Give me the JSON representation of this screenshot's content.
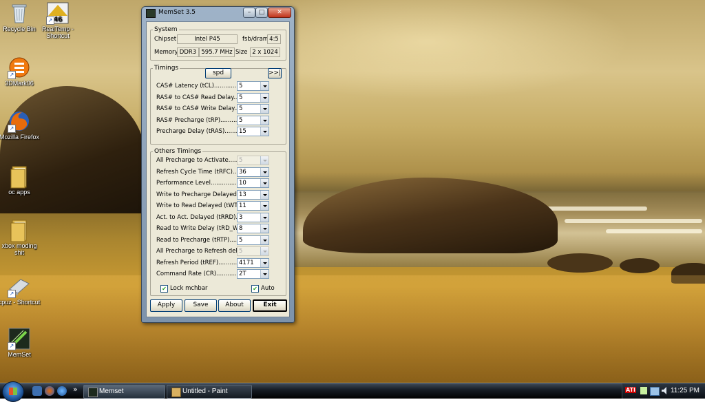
{
  "desktop": {
    "icons": [
      {
        "label": "Recycle Bin"
      },
      {
        "label": "RealTemp - Shortcut",
        "badge": "46"
      },
      {
        "label": "3DMark06"
      },
      {
        "label": "Mozilla Firefox"
      },
      {
        "label": "oc apps"
      },
      {
        "label": "xbox moding shit"
      },
      {
        "label": "cpuz - Shortcut"
      },
      {
        "label": "MemSet"
      }
    ]
  },
  "window": {
    "title": "MemSet 3.5",
    "controls": {
      "minimize": "–",
      "maximize": "□",
      "close": "✕"
    },
    "system": {
      "legend": "System",
      "chipset_label": "Chipset",
      "chipset_value": "Intel P45",
      "fsb_label": "fsb/dram",
      "fsb_value": "4:5",
      "memory_label": "Memory",
      "memory_type": "DDR3",
      "memory_freq": "595.7 MHz",
      "size_label": "Size",
      "size_value": "2 x 1024"
    },
    "timings": {
      "legend": "Timings",
      "spd_button": "spd",
      "expand_button": ">>|",
      "rows": [
        {
          "label": "CAS# Latency (tCL)...............",
          "value": "5",
          "disabled": false
        },
        {
          "label": "RAS# to CAS# Read Delay........",
          "value": "5",
          "disabled": false
        },
        {
          "label": "RAS# to CAS# Write Delay.......",
          "value": "5",
          "disabled": false
        },
        {
          "label": "RAS# Precharge (tRP).............",
          "value": "5",
          "disabled": false
        },
        {
          "label": "Precharge Delay  (tRAS)...........",
          "value": "15",
          "disabled": false
        }
      ]
    },
    "others": {
      "legend": "Others Timings",
      "rows": [
        {
          "label": "All Precharge to Activate...............",
          "value": "5",
          "disabled": true
        },
        {
          "label": "Refresh Cycle Time (tRFC)...........",
          "value": "36",
          "disabled": false
        },
        {
          "label": "Performance Level.......................",
          "value": "10",
          "disabled": false
        },
        {
          "label": "Write to Precharge Delayed.........",
          "value": "13",
          "disabled": false
        },
        {
          "label": "Write to Read Delayed (tWTR).......",
          "value": "11",
          "disabled": false
        },
        {
          "label": "Act. to Act. Delayed (tRRD)..........",
          "value": "3",
          "disabled": false
        },
        {
          "label": "Read to Write Delay (tRD_WR).......",
          "value": "8",
          "disabled": false
        },
        {
          "label": "Read to Precharge (tRTP)............",
          "value": "5",
          "disabled": false
        },
        {
          "label": "All Precharge to Refresh delay.........",
          "value": "5",
          "disabled": true
        },
        {
          "label": "Refresh Period (tREF)..................",
          "value": "4171",
          "disabled": false
        },
        {
          "label": "Command Rate (CR)....................",
          "value": "2T",
          "disabled": false
        }
      ],
      "lock_label": "Lock mchbar",
      "lock_checked": true,
      "auto_label": "Auto",
      "auto_checked": true
    },
    "buttons": {
      "apply": "Apply",
      "save": "Save",
      "about": "About",
      "exit": "Exit"
    }
  },
  "taskbar": {
    "tasks": [
      {
        "label": "Memset",
        "active": true
      },
      {
        "label": "Untitled - Paint",
        "active": false
      }
    ],
    "overflow": "»",
    "tray_text": "ATI",
    "clock": "11:25 PM"
  }
}
